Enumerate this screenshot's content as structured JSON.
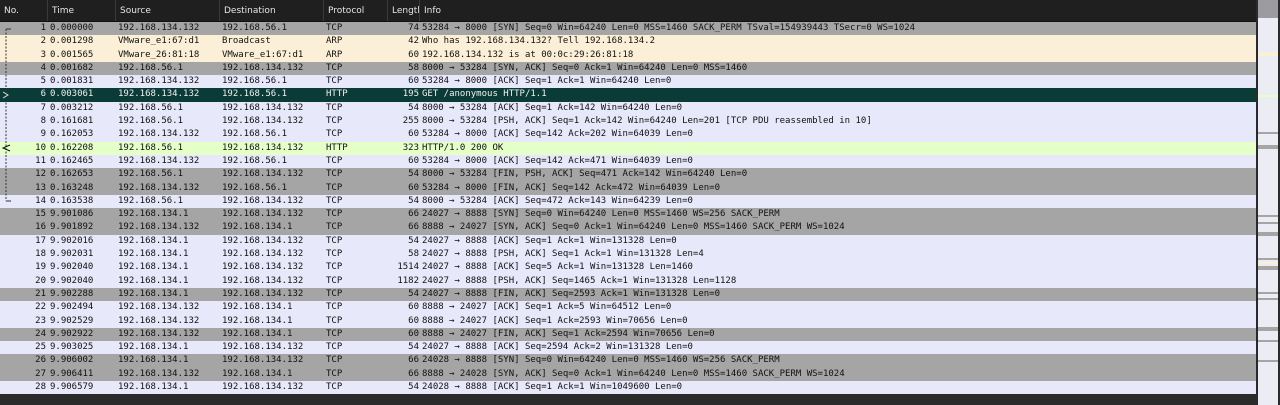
{
  "columns": {
    "no": "No.",
    "time": "Time",
    "source": "Source",
    "destination": "Destination",
    "protocol": "Protocol",
    "length": "Lengtl",
    "info": "Info"
  },
  "selected_row": 6,
  "row_colors": {
    "grey": "#a5a5a5",
    "lavender": "#e8e8fb",
    "beige": "#fbf0d7",
    "green": "#e4ffc8",
    "selected": "#0b3b37"
  },
  "packets": [
    {
      "no": "1",
      "time": "0.000000",
      "src": "192.168.134.132",
      "dst": "192.168.56.1",
      "proto": "TCP",
      "len": "74",
      "info": "53284 → 8000 [SYN] Seq=0 Win=64240 Len=0 MSS=1460 SACK_PERM TSval=154939443 TSecr=0 WS=1024",
      "color": "grey"
    },
    {
      "no": "2",
      "time": "0.001298",
      "src": "VMware_e1:67:d1",
      "dst": "Broadcast",
      "proto": "ARP",
      "len": "42",
      "info": "Who has 192.168.134.132? Tell 192.168.134.2",
      "color": "beige"
    },
    {
      "no": "3",
      "time": "0.001565",
      "src": "VMware_26:81:18",
      "dst": "VMware_e1:67:d1",
      "proto": "ARP",
      "len": "60",
      "info": "192.168.134.132 is at 00:0c:29:26:81:18",
      "color": "beige"
    },
    {
      "no": "4",
      "time": "0.001682",
      "src": "192.168.56.1",
      "dst": "192.168.134.132",
      "proto": "TCP",
      "len": "58",
      "info": "8000 → 53284 [SYN, ACK] Seq=0 Ack=1 Win=64240 Len=0 MSS=1460",
      "color": "grey"
    },
    {
      "no": "5",
      "time": "0.001831",
      "src": "192.168.134.132",
      "dst": "192.168.56.1",
      "proto": "TCP",
      "len": "60",
      "info": "53284 → 8000 [ACK] Seq=1 Ack=1 Win=64240 Len=0",
      "color": "lavender"
    },
    {
      "no": "6",
      "time": "0.003061",
      "src": "192.168.134.132",
      "dst": "192.168.56.1",
      "proto": "HTTP",
      "len": "195",
      "info": "GET /anonymous HTTP/1.1",
      "color": "selected"
    },
    {
      "no": "7",
      "time": "0.003212",
      "src": "192.168.56.1",
      "dst": "192.168.134.132",
      "proto": "TCP",
      "len": "54",
      "info": "8000 → 53284 [ACK] Seq=1 Ack=142 Win=64240 Len=0",
      "color": "lavender"
    },
    {
      "no": "8",
      "time": "0.161681",
      "src": "192.168.56.1",
      "dst": "192.168.134.132",
      "proto": "TCP",
      "len": "255",
      "info": "8000 → 53284 [PSH, ACK] Seq=1 Ack=142 Win=64240 Len=201 [TCP PDU reassembled in 10]",
      "color": "lavender"
    },
    {
      "no": "9",
      "time": "0.162053",
      "src": "192.168.134.132",
      "dst": "192.168.56.1",
      "proto": "TCP",
      "len": "60",
      "info": "53284 → 8000 [ACK] Seq=142 Ack=202 Win=64039 Len=0",
      "color": "lavender"
    },
    {
      "no": "10",
      "time": "0.162208",
      "src": "192.168.56.1",
      "dst": "192.168.134.132",
      "proto": "HTTP",
      "len": "323",
      "info": "HTTP/1.0 200 OK",
      "color": "green"
    },
    {
      "no": "11",
      "time": "0.162465",
      "src": "192.168.134.132",
      "dst": "192.168.56.1",
      "proto": "TCP",
      "len": "60",
      "info": "53284 → 8000 [ACK] Seq=142 Ack=471 Win=64039 Len=0",
      "color": "lavender"
    },
    {
      "no": "12",
      "time": "0.162653",
      "src": "192.168.56.1",
      "dst": "192.168.134.132",
      "proto": "TCP",
      "len": "54",
      "info": "8000 → 53284 [FIN, PSH, ACK] Seq=471 Ack=142 Win=64240 Len=0",
      "color": "grey"
    },
    {
      "no": "13",
      "time": "0.163248",
      "src": "192.168.134.132",
      "dst": "192.168.56.1",
      "proto": "TCP",
      "len": "60",
      "info": "53284 → 8000 [FIN, ACK] Seq=142 Ack=472 Win=64039 Len=0",
      "color": "grey"
    },
    {
      "no": "14",
      "time": "0.163538",
      "src": "192.168.56.1",
      "dst": "192.168.134.132",
      "proto": "TCP",
      "len": "54",
      "info": "8000 → 53284 [ACK] Seq=472 Ack=143 Win=64239 Len=0",
      "color": "lavender"
    },
    {
      "no": "15",
      "time": "9.901086",
      "src": "192.168.134.1",
      "dst": "192.168.134.132",
      "proto": "TCP",
      "len": "66",
      "info": "24027 → 8888 [SYN] Seq=0 Win=64240 Len=0 MSS=1460 WS=256 SACK_PERM",
      "color": "grey"
    },
    {
      "no": "16",
      "time": "9.901892",
      "src": "192.168.134.132",
      "dst": "192.168.134.1",
      "proto": "TCP",
      "len": "66",
      "info": "8888 → 24027 [SYN, ACK] Seq=0 Ack=1 Win=64240 Len=0 MSS=1460 SACK_PERM WS=1024",
      "color": "grey"
    },
    {
      "no": "17",
      "time": "9.902016",
      "src": "192.168.134.1",
      "dst": "192.168.134.132",
      "proto": "TCP",
      "len": "54",
      "info": "24027 → 8888 [ACK] Seq=1 Ack=1 Win=131328 Len=0",
      "color": "lavender"
    },
    {
      "no": "18",
      "time": "9.902031",
      "src": "192.168.134.1",
      "dst": "192.168.134.132",
      "proto": "TCP",
      "len": "58",
      "info": "24027 → 8888 [PSH, ACK] Seq=1 Ack=1 Win=131328 Len=4",
      "color": "lavender"
    },
    {
      "no": "19",
      "time": "9.902040",
      "src": "192.168.134.1",
      "dst": "192.168.134.132",
      "proto": "TCP",
      "len": "1514",
      "info": "24027 → 8888 [ACK] Seq=5 Ack=1 Win=131328 Len=1460",
      "color": "lavender"
    },
    {
      "no": "20",
      "time": "9.902040",
      "src": "192.168.134.1",
      "dst": "192.168.134.132",
      "proto": "TCP",
      "len": "1182",
      "info": "24027 → 8888 [PSH, ACK] Seq=1465 Ack=1 Win=131328 Len=1128",
      "color": "lavender"
    },
    {
      "no": "21",
      "time": "9.902288",
      "src": "192.168.134.1",
      "dst": "192.168.134.132",
      "proto": "TCP",
      "len": "54",
      "info": "24027 → 8888 [FIN, ACK] Seq=2593 Ack=1 Win=131328 Len=0",
      "color": "grey"
    },
    {
      "no": "22",
      "time": "9.902494",
      "src": "192.168.134.132",
      "dst": "192.168.134.1",
      "proto": "TCP",
      "len": "60",
      "info": "8888 → 24027 [ACK] Seq=1 Ack=5 Win=64512 Len=0",
      "color": "lavender"
    },
    {
      "no": "23",
      "time": "9.902529",
      "src": "192.168.134.132",
      "dst": "192.168.134.1",
      "proto": "TCP",
      "len": "60",
      "info": "8888 → 24027 [ACK] Seq=1 Ack=2593 Win=70656 Len=0",
      "color": "lavender"
    },
    {
      "no": "24",
      "time": "9.902922",
      "src": "192.168.134.132",
      "dst": "192.168.134.1",
      "proto": "TCP",
      "len": "60",
      "info": "8888 → 24027 [FIN, ACK] Seq=1 Ack=2594 Win=70656 Len=0",
      "color": "grey"
    },
    {
      "no": "25",
      "time": "9.903025",
      "src": "192.168.134.1",
      "dst": "192.168.134.132",
      "proto": "TCP",
      "len": "54",
      "info": "24027 → 8888 [ACK] Seq=2594 Ack=2 Win=131328 Len=0",
      "color": "lavender"
    },
    {
      "no": "26",
      "time": "9.906002",
      "src": "192.168.134.1",
      "dst": "192.168.134.132",
      "proto": "TCP",
      "len": "66",
      "info": "24028 → 8888 [SYN] Seq=0 Win=64240 Len=0 MSS=1460 WS=256 SACK_PERM",
      "color": "grey"
    },
    {
      "no": "27",
      "time": "9.906411",
      "src": "192.168.134.132",
      "dst": "192.168.134.1",
      "proto": "TCP",
      "len": "66",
      "info": "8888 → 24028 [SYN, ACK] Seq=0 Ack=1 Win=64240 Len=0 MSS=1460 SACK_PERM WS=1024",
      "color": "grey"
    },
    {
      "no": "28",
      "time": "9.906579",
      "src": "192.168.134.1",
      "dst": "192.168.134.132",
      "proto": "TCP",
      "len": "54",
      "info": "24028 → 8888 [ACK] Seq=1 Ack=1 Win=1049600 Len=0",
      "color": "lavender"
    }
  ]
}
